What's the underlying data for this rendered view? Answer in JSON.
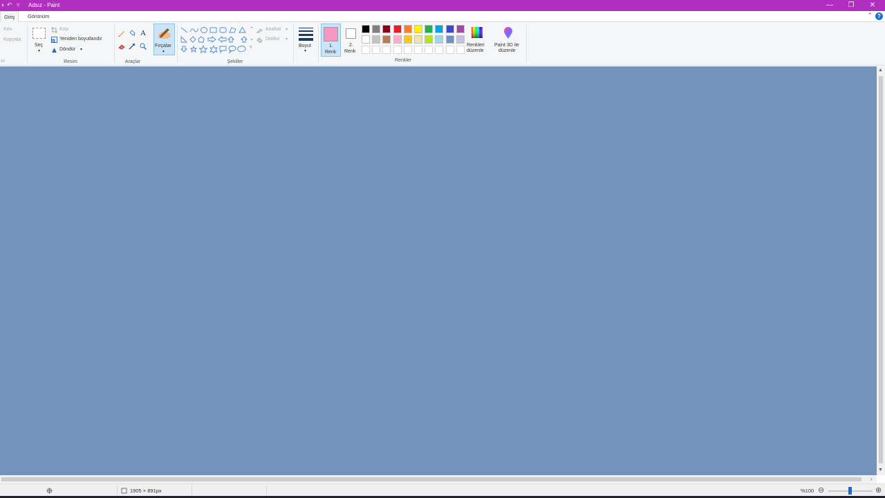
{
  "window": {
    "title": "Adsız - Paint",
    "minimize": "—",
    "restore": "❐",
    "close": "✕"
  },
  "tabs": [
    {
      "label": "Giriş",
      "active": true
    },
    {
      "label": "Görünüm",
      "active": false
    }
  ],
  "clipboard": {
    "cut": "Kes",
    "copy": "Kopyala"
  },
  "image_group": {
    "label": "Resim",
    "select": "Seç",
    "crop": "Kırp",
    "resize": "Yeniden boyutlandır",
    "rotate": "Döndür"
  },
  "tools_group": {
    "label": "Araçlar"
  },
  "brushes": {
    "label": "Fırçalar"
  },
  "shapes_group": {
    "label": "Şekiller",
    "outline": "Anahat",
    "fill": "Doldur"
  },
  "size": {
    "label": "Boyut"
  },
  "color1": {
    "label_line1": "1.",
    "label_line2": "Renk",
    "color": "#f49ac2"
  },
  "color2": {
    "label_line1": "2.",
    "label_line2": "Renk",
    "color": "#ffffff"
  },
  "colors_group": {
    "label": "Renkler"
  },
  "edit_colors": {
    "line1": "Renkleri",
    "line2": "düzenle"
  },
  "paint3d": {
    "line1": "Paint 3D ile",
    "line2": "düzenle"
  },
  "palette_row1": [
    "#000000",
    "#7f7f7f",
    "#880015",
    "#ed1c24",
    "#ff7f27",
    "#fff200",
    "#22b14c",
    "#00a2e8",
    "#3f48cc",
    "#a349a4"
  ],
  "palette_row2": [
    "#ffffff",
    "#c3c3c3",
    "#b97a57",
    "#ffaec9",
    "#ffc90e",
    "#efe4b0",
    "#b5e61d",
    "#99d9ea",
    "#7092be",
    "#c8bfe7"
  ],
  "canvas_color": "#7393bc",
  "status": {
    "image_size": "1905 × 891px",
    "zoom": "%100"
  }
}
